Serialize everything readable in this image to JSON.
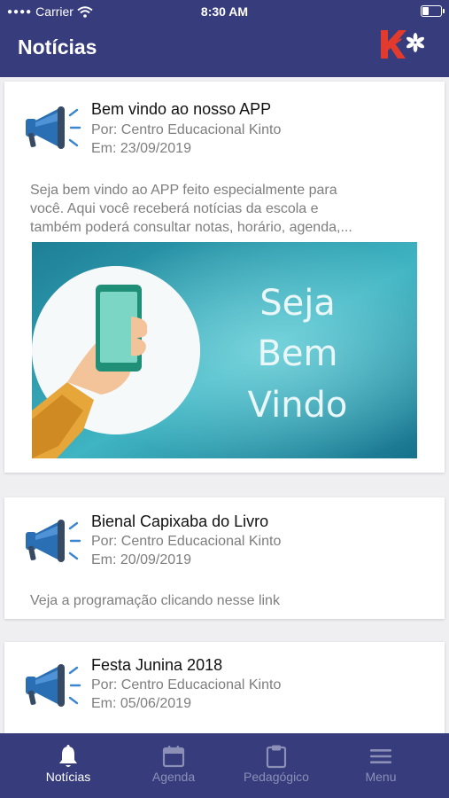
{
  "status_bar": {
    "carrier": "Carrier",
    "time": "8:30 AM"
  },
  "header": {
    "title": "Notícias",
    "logo": "kinto-logo"
  },
  "news": [
    {
      "title": "Bem vindo ao nosso APP",
      "author": "Por: Centro Educacional Kinto",
      "date": "Em: 23/09/2019",
      "summary_line1": "Seja bem vindo ao APP feito especialmente para",
      "summary_line2": "você. Aqui você receberá notícias da escola e",
      "summary_line3": "também poderá consultar notas, horário, agenda,...",
      "banner": {
        "word1": "Seja",
        "word2": "Bem",
        "word3": "Vindo"
      }
    },
    {
      "title": "Bienal Capixaba do Livro",
      "author": "Por: Centro Educacional Kinto",
      "date": "Em: 20/09/2019",
      "summary_line1": "Veja a programação clicando nesse link"
    },
    {
      "title": "Festa Junina 2018",
      "author": "Por: Centro Educacional Kinto",
      "date": "Em: 05/06/2019"
    }
  ],
  "tabs": [
    {
      "label": "Notícias",
      "icon": "bell-icon",
      "active": true
    },
    {
      "label": "Agenda",
      "icon": "calendar-icon",
      "active": false
    },
    {
      "label": "Pedagógico",
      "icon": "clipboard-icon",
      "active": false
    },
    {
      "label": "Menu",
      "icon": "hamburger-icon",
      "active": false
    }
  ],
  "colors": {
    "primary": "#363c7c",
    "tab_inactive": "#8c90b6",
    "megaphone_blue": "#2a6fb3",
    "banner_teal": "#2aa3b3"
  }
}
